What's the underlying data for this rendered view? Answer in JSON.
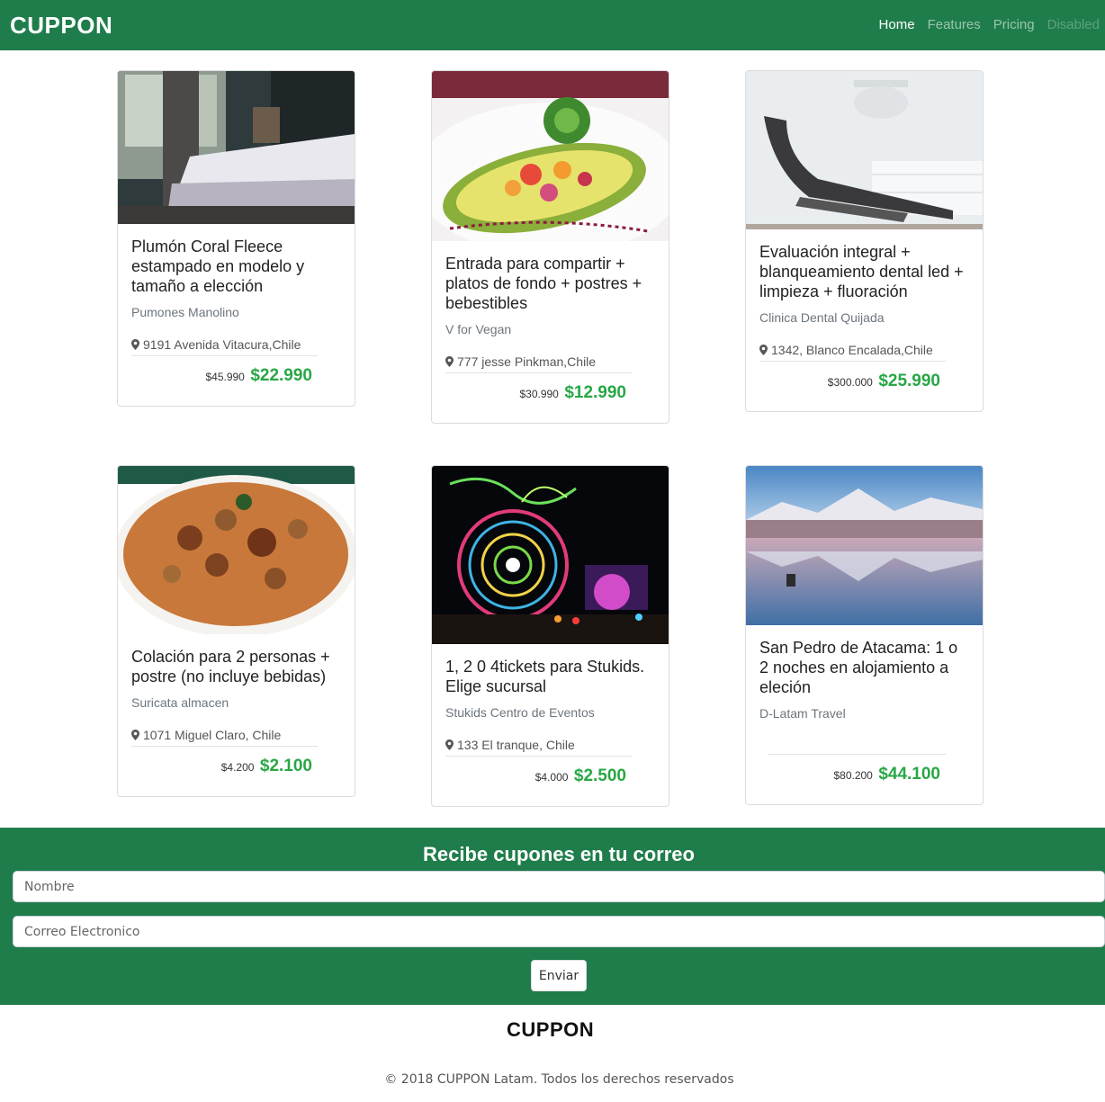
{
  "header": {
    "brand": "CUPPON",
    "nav": [
      {
        "label": "Home",
        "state": "active"
      },
      {
        "label": "Features",
        "state": "normal"
      },
      {
        "label": "Pricing",
        "state": "normal"
      },
      {
        "label": "Disabled",
        "state": "disabled"
      }
    ]
  },
  "deals": [
    {
      "image": "bedroom-photo",
      "title": "Plumón Coral Fleece estampado en modelo y tamaño a elección",
      "vendor": "Pumones Manolino",
      "address": "9191 Avenida Vitacura,Chile",
      "old_price": "$45.990",
      "price": "$22.990"
    },
    {
      "image": "avocado-dish-photo",
      "title": "Entrada para compartir + platos de fondo + postres + bebestibles",
      "vendor": "V for Vegan",
      "address": "777 jesse Pinkman,Chile",
      "old_price": "$30.990",
      "price": "$12.990"
    },
    {
      "image": "dental-chair-photo",
      "title": "Evaluación integral + blanqueamiento dental led + limpieza + fluoración",
      "vendor": "Clinica Dental Quijada",
      "address": "1342, Blanco Encalada,Chile",
      "old_price": "$300.000",
      "price": "$25.990"
    },
    {
      "image": "stew-dish-photo",
      "title": "Colación para 2 personas + postre (no incluye bebidas)",
      "vendor": "Suricata almacen",
      "address": "1071 Miguel Claro, Chile",
      "old_price": "$4.200",
      "price": "$2.100"
    },
    {
      "image": "ferris-wheel-night-photo",
      "title": "1, 2 0 4tickets para Stukids. Elige sucursal",
      "vendor": "Stukids Centro de Eventos",
      "address": "133 El tranque, Chile",
      "old_price": "$4.000",
      "price": "$2.500"
    },
    {
      "image": "atacama-mountains-photo",
      "title": "San Pedro de Atacama: 1 o 2 noches en alojamiento a eleción",
      "vendor": "D-Latam Travel",
      "address": "",
      "old_price": "$80.200",
      "price": "$44.100"
    }
  ],
  "subscribe": {
    "heading": "Recibe cupones en tu correo",
    "name_placeholder": "Nombre",
    "email_placeholder": "Correo Electronico",
    "submit_label": "Enviar"
  },
  "footer": {
    "brand": "CUPPON",
    "copyright": "© 2018 CUPPON Latam. Todos los derechos reservados"
  },
  "colors": {
    "brand_green": "#1f7d4b",
    "price_green": "#28a745"
  }
}
